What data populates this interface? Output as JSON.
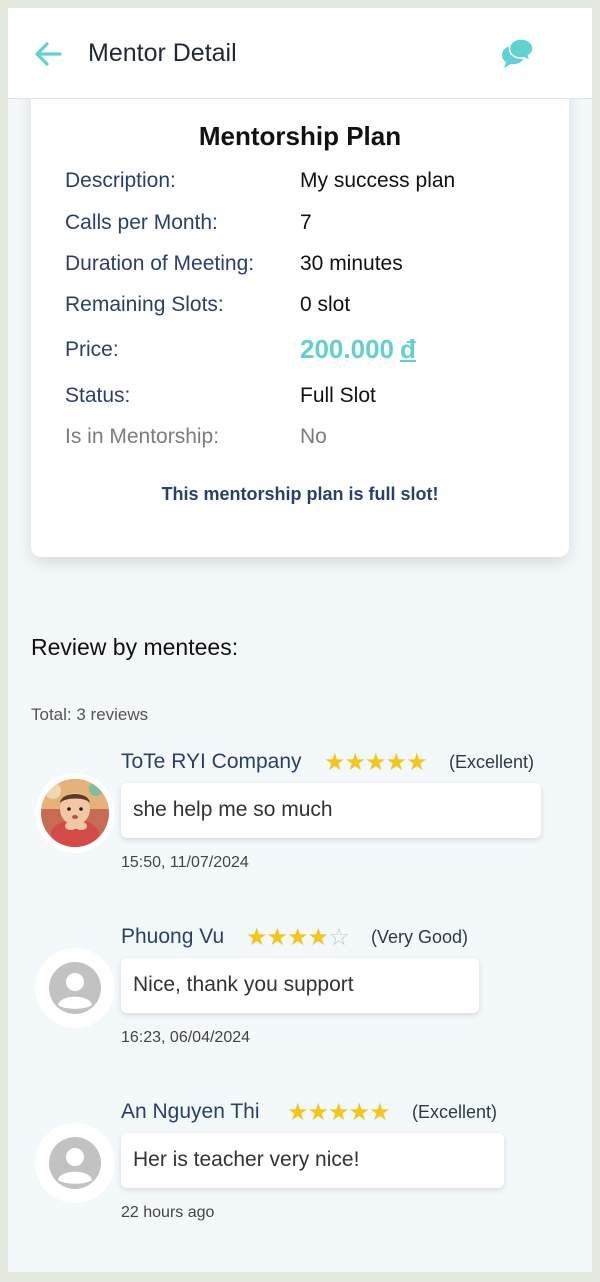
{
  "header": {
    "title": "Mentor Detail",
    "back_icon": "arrow-left-icon",
    "chat_icon": "chat-bubbles-icon",
    "accent": "#5fd3d1"
  },
  "plan": {
    "title": "Mentorship Plan",
    "rows": [
      {
        "label": "Description:",
        "value": "My success plan"
      },
      {
        "label": "Calls per Month:",
        "value": "7"
      },
      {
        "label": "Duration of Meeting:",
        "value": "30 minutes"
      },
      {
        "label": "Remaining Slots:",
        "value": "0 slot"
      },
      {
        "label": "Price:",
        "value": "200.000",
        "currency": "đ"
      },
      {
        "label": "Status:",
        "value": "Full Slot"
      },
      {
        "label": "Is in Mentorship:",
        "value": "No"
      }
    ],
    "note": "This mentorship plan is full slot!"
  },
  "reviews": {
    "heading": "Review by mentees:",
    "total": "Total: 3 reviews",
    "items": [
      {
        "name": "ToTe RYI Company",
        "stars": 5,
        "rating_label": "(Excellent)",
        "comment": "she help me so much",
        "time": "15:50, 11/07/2024",
        "avatar": "child-photo"
      },
      {
        "name": "Phuong Vu",
        "stars": 4,
        "rating_label": "(Very Good)",
        "comment": "Nice, thank you support",
        "time": "16:23, 06/04/2024",
        "avatar": "default-user-icon"
      },
      {
        "name": "An Nguyen Thi",
        "stars": 5,
        "rating_label": "(Excellent)",
        "comment": "Her is teacher very nice!",
        "time": "22 hours ago",
        "avatar": "default-user-icon"
      }
    ]
  },
  "colors": {
    "label": "#2b3f6b",
    "price": "#62d0cf",
    "star": "#f5c518",
    "page_bg": "#f3f8fb"
  }
}
